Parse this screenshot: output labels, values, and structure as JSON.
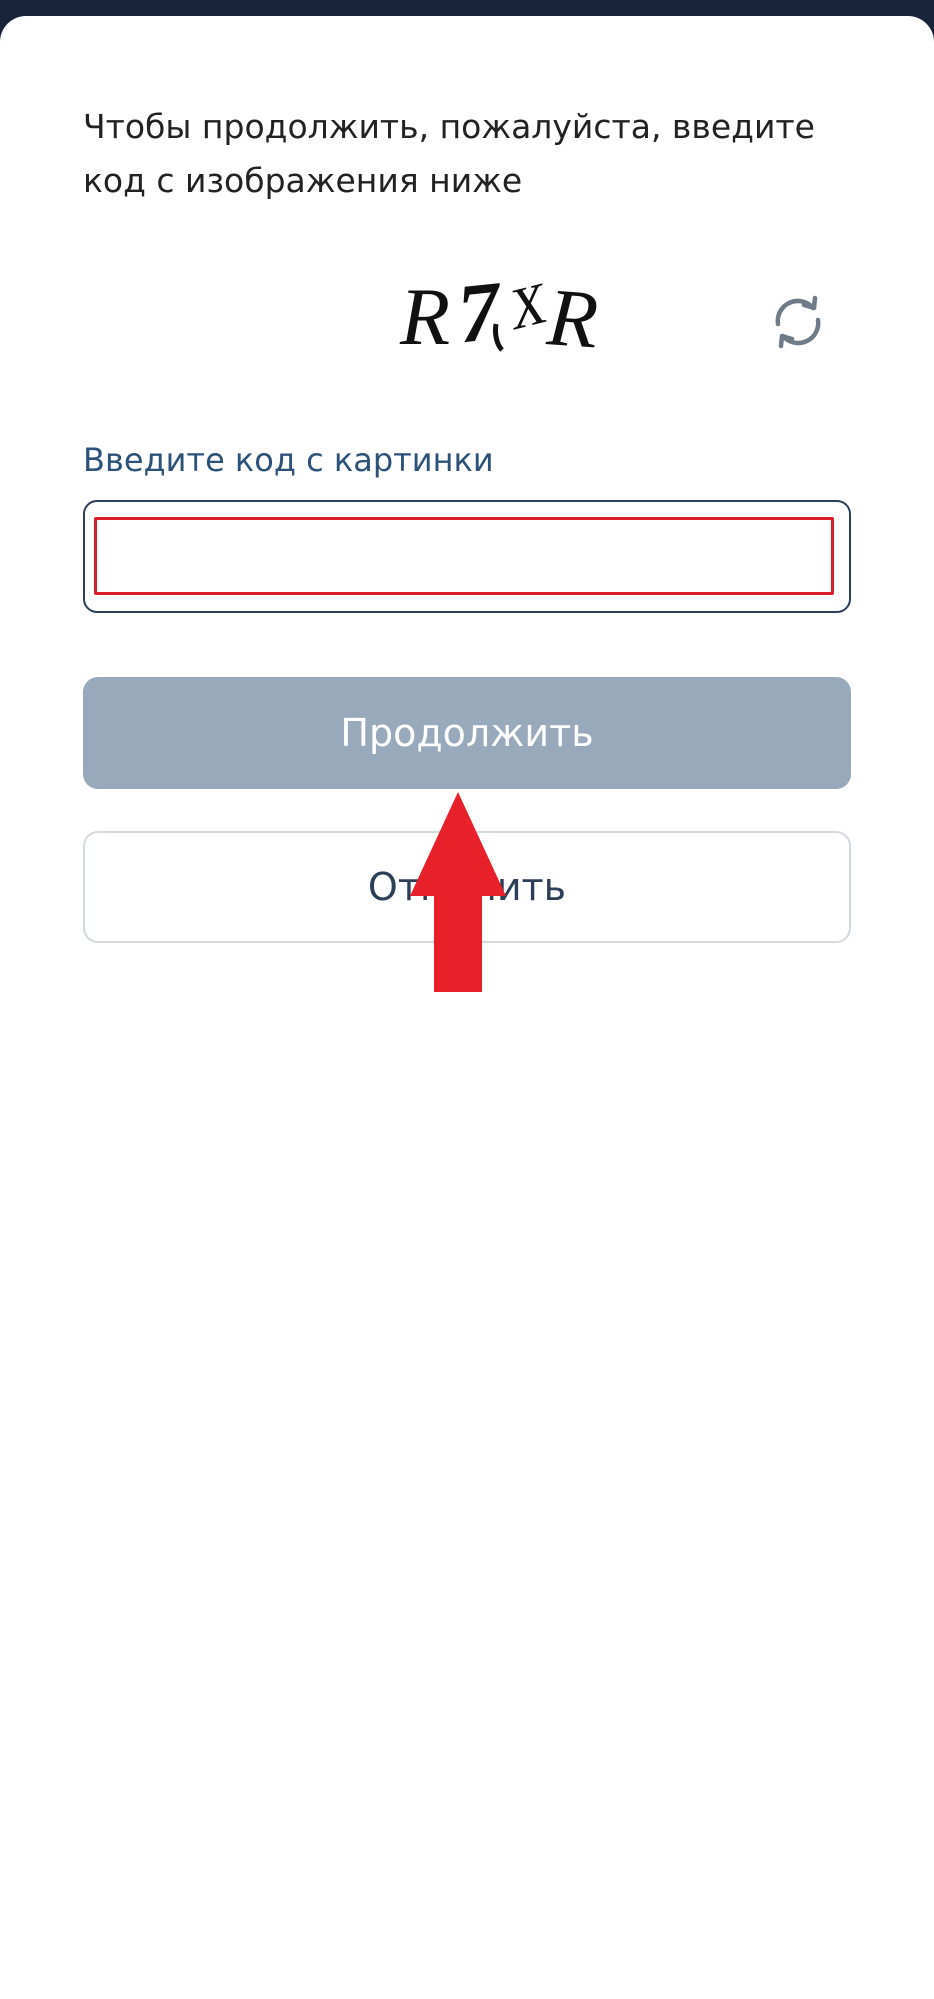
{
  "captcha_dialog": {
    "prompt_line1": "Чтобы продолжить, пожалуйста, введите",
    "prompt_line2": "код с изображения ниже",
    "captcha_image": {
      "chars": [
        "R",
        "7",
        "X",
        "R"
      ]
    },
    "refresh_icon": "refresh-icon",
    "field_label": "Введите код с картинки",
    "code_input": {
      "value": "",
      "placeholder": ""
    },
    "continue_label": "Продолжить",
    "cancel_label": "Отменить"
  },
  "colors": {
    "top_bar": "#19243a",
    "label_blue": "#2b5278",
    "input_border": "#2b3f5c",
    "highlight_red": "#d6202c",
    "continue_bg": "#97a9ba",
    "cancel_text": "#2c3f57",
    "arrow_red": "#e8202a"
  }
}
